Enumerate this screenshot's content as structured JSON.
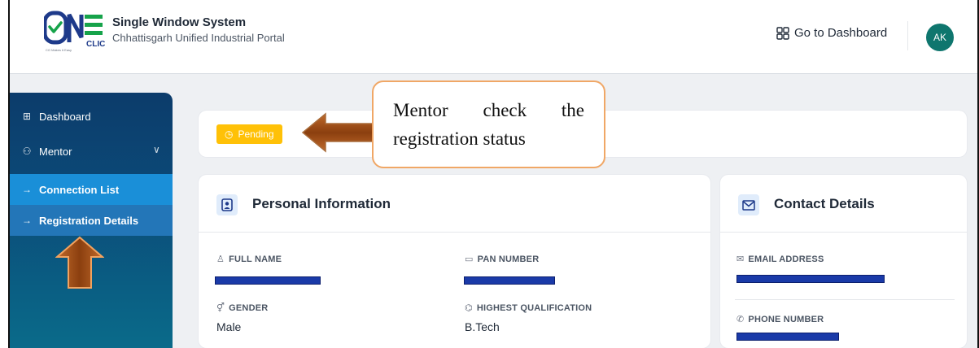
{
  "header": {
    "logo_text": "ONE CLICK",
    "logo_tagline": "CG Makes it Easy",
    "title": "Single Window System",
    "subtitle": "Chhattisgarh Unified Industrial Portal",
    "go_dashboard": "Go to Dashboard",
    "avatar_initials": "AK"
  },
  "sidebar": {
    "items": [
      {
        "label": "Dashboard",
        "icon": "grid-icon"
      },
      {
        "label": "Mentor",
        "icon": "users-icon"
      },
      {
        "label": "Connection List",
        "icon": "arrow-right-icon"
      },
      {
        "label": "Registration Details",
        "icon": "arrow-right-icon"
      }
    ]
  },
  "status": {
    "badge": "Pending",
    "color": "#ffc107"
  },
  "annotation": {
    "line1": "Mentor check the",
    "line2": "registration status"
  },
  "personal_info": {
    "title": "Personal Information",
    "full_name_label": "FULL NAME",
    "pan_label": "PAN NUMBER",
    "gender_label": "GENDER",
    "gender_value": "Male",
    "qualification_label": "HIGHEST QUALIFICATION",
    "qualification_value": "B.Tech"
  },
  "contact": {
    "title": "Contact Details",
    "email_label": "EMAIL ADDRESS",
    "phone_label": "PHONE NUMBER"
  },
  "colors": {
    "sidebar_top": "#0c3c6b",
    "sidebar_active": "#1a8fd8",
    "accent_teal": "#0f766e",
    "arrow_brown": "#a0522d",
    "callout_border": "#f0a766",
    "redaction": "#1a3aa8"
  }
}
